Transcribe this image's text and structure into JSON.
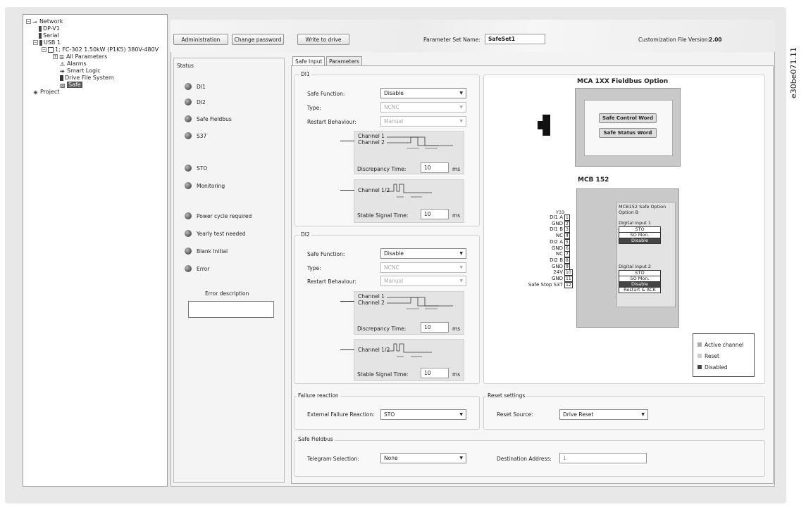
{
  "side_id": "e30be071.11",
  "tree": {
    "network": "Network",
    "dpv1": "DP-V1",
    "serial": "Serial",
    "usb": "USB 1",
    "drive": "1; FC-302 1.50kW (P1K5) 380V-480V",
    "all_params": "All Parameters",
    "alarms": "Alarms",
    "smart_logic": "Smart Logic",
    "dfs": "Drive File System",
    "safe": "Safe",
    "project": "Project"
  },
  "toolbar": {
    "administration": "Administration",
    "change_password": "Change password",
    "write_to_drive": "Write to drive",
    "param_set_label": "Parameter Set Name:",
    "param_set_value": "SafeSet1",
    "cust_label": "Customization File Version:",
    "cust_value": "2.00"
  },
  "status": {
    "title": "Status",
    "items": [
      "DI1",
      "DI2",
      "Safe Fieldbus",
      "S37",
      "STO",
      "Monitoring",
      "Power cycle required",
      "Yearly test needed",
      "Blank Initial",
      "Error"
    ],
    "error_desc": "Error description"
  },
  "tabs": {
    "safe_input": "Safe Input",
    "parameters": "Parameters"
  },
  "di1": {
    "title": "DI1",
    "safe_function_label": "Safe Function:",
    "safe_function": "Disable",
    "type_label": "Type:",
    "type": "NCNC",
    "restart_label": "Restart Behaviour:",
    "restart": "Manual",
    "ch1": "Channel 1",
    "ch2": "Channel 2",
    "discrepancy_label": "Discrepancy Time:",
    "discrepancy": "10",
    "ch12": "Channel 1/2",
    "stable_label": "Stable Signal Time:",
    "stable": "10",
    "ms": "ms"
  },
  "di2": {
    "title": "DI2",
    "safe_function_label": "Safe Function:",
    "safe_function": "Disable",
    "type_label": "Type:",
    "type": "NCNC",
    "restart_label": "Restart Behaviour:",
    "restart": "Manual",
    "ch1": "Channel 1",
    "ch2": "Channel 2",
    "discrepancy_label": "Discrepancy Time:",
    "discrepancy": "10",
    "ch12": "Channel 1/2",
    "stable_label": "Stable Signal Time:",
    "stable": "10",
    "ms": "ms"
  },
  "mca": {
    "title": "MCA 1XX Fieldbus Option",
    "control_word": "Safe Control Word",
    "status_word": "Safe Status Word"
  },
  "mcb": {
    "title": "MCB 152",
    "y33": "Y33",
    "terminals": [
      "DI1 A",
      "GND",
      "DI1 B",
      "NC",
      "DI2 A",
      "GND",
      "NC",
      "DI2 B",
      "GND",
      "24V",
      "GND",
      "Safe Stop S37"
    ],
    "numbers": [
      "1",
      "2",
      "3",
      "4",
      "5",
      "6",
      "7",
      "8",
      "9",
      "10",
      "11",
      "12"
    ],
    "opt_title": "MCB152 Safe Option",
    "opt_sub": "Option B",
    "dig1": "Digital input 1",
    "dig1_items": [
      "STO",
      "SO Mon.",
      "Disable"
    ],
    "dig2": "Digital input 2",
    "dig2_items": [
      "STO",
      "SO Mon.",
      "Disable",
      "Restart & ACK"
    ]
  },
  "legend": {
    "active": "Active channel",
    "reset": "Reset",
    "disabled": "Disabled"
  },
  "failure": {
    "title": "Failure reaction",
    "label": "External Failure Reaction:",
    "value": "STO"
  },
  "reset": {
    "title": "Reset settings",
    "label": "Reset Source:",
    "value": "Drive Reset"
  },
  "fieldbus": {
    "title": "Safe Fieldbus",
    "telegram_label": "Telegram Selection:",
    "telegram": "None",
    "dest_label": "Destination Address:",
    "dest": "1"
  }
}
